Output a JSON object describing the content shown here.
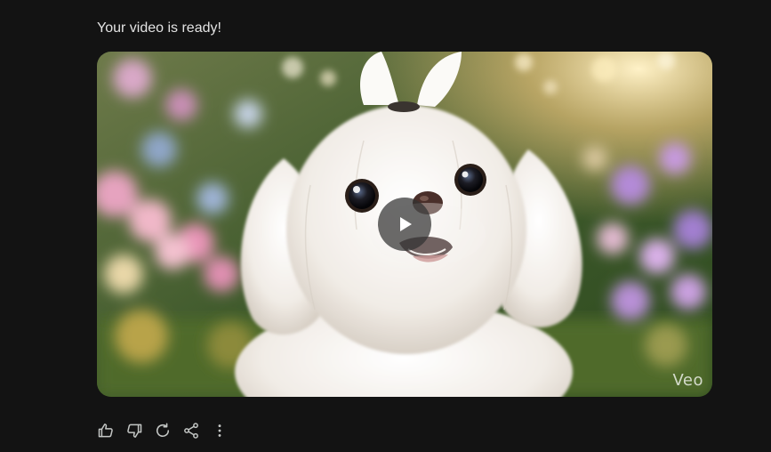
{
  "message": {
    "title": "Your video is ready!"
  },
  "video": {
    "watermark": "Veo",
    "play_icon": "play-icon"
  },
  "actions": {
    "items": [
      {
        "name": "thumbs-up-icon"
      },
      {
        "name": "thumbs-down-icon"
      },
      {
        "name": "regenerate-icon"
      },
      {
        "name": "share-icon"
      },
      {
        "name": "more-options-icon"
      }
    ]
  },
  "colors": {
    "background": "#131313",
    "text": "#e3e3e3",
    "icon": "#c4c7c5"
  }
}
